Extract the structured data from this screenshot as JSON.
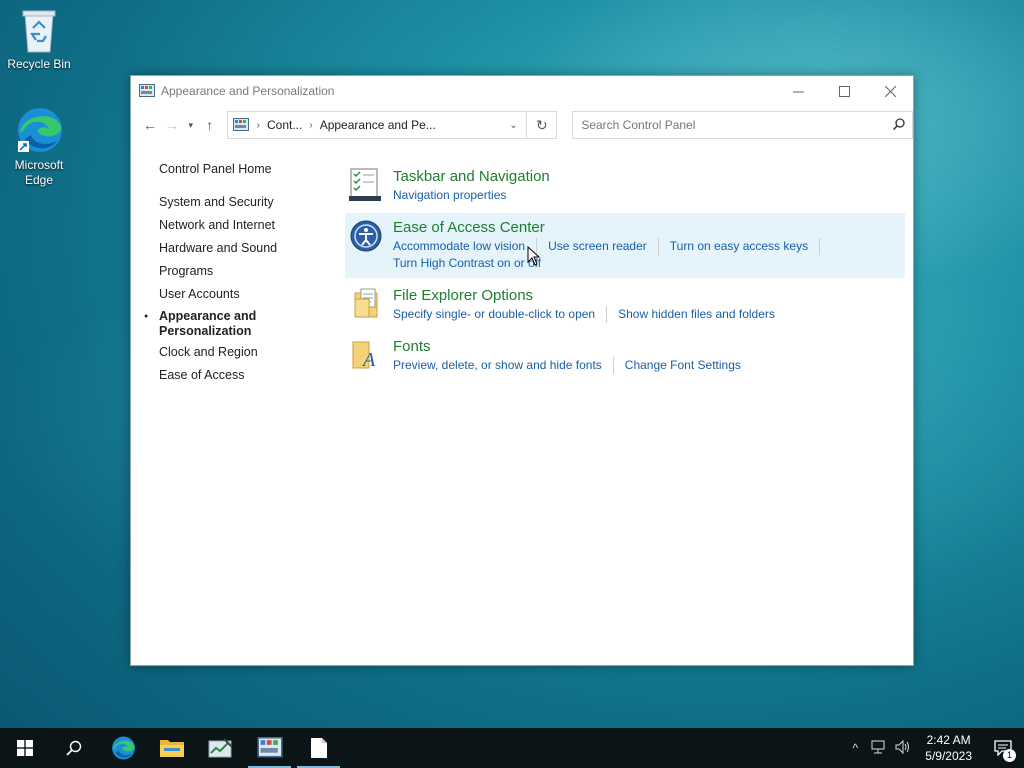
{
  "desktop": {
    "icons": [
      {
        "label": "Recycle Bin"
      },
      {
        "label": "Microsoft Edge"
      }
    ]
  },
  "window": {
    "title": "Appearance and Personalization",
    "address": {
      "crumbs": [
        "Cont...",
        "Appearance and Pe..."
      ]
    },
    "search": {
      "placeholder": "Search Control Panel"
    },
    "leftnav": {
      "home": "Control Panel Home",
      "items": [
        {
          "label": "System and Security"
        },
        {
          "label": "Network and Internet"
        },
        {
          "label": "Hardware and Sound"
        },
        {
          "label": "Programs"
        },
        {
          "label": "User Accounts"
        },
        {
          "label": "Appearance and Personalization",
          "current": true
        },
        {
          "label": "Clock and Region"
        },
        {
          "label": "Ease of Access"
        }
      ]
    },
    "sections": [
      {
        "title": "Taskbar and Navigation",
        "links": [
          "Navigation properties"
        ]
      },
      {
        "title": "Ease of Access Center",
        "links": [
          "Accommodate low vision",
          "Use screen reader",
          "Turn on easy access keys",
          "Turn High Contrast on or off"
        ]
      },
      {
        "title": "File Explorer Options",
        "links": [
          "Specify single- or double-click to open",
          "Show hidden files and folders"
        ]
      },
      {
        "title": "Fonts",
        "links": [
          "Preview, delete, or show and hide fonts",
          "Change Font Settings"
        ]
      }
    ]
  },
  "taskbar": {
    "clock": {
      "time": "2:42 AM",
      "date": "5/9/2023"
    },
    "notification_count": "1"
  },
  "colors": {
    "section_title": "#1e7d2f",
    "link": "#1a5fa8",
    "hover_bg": "#e5f3fb",
    "taskbar_bg": "#0b1416"
  }
}
